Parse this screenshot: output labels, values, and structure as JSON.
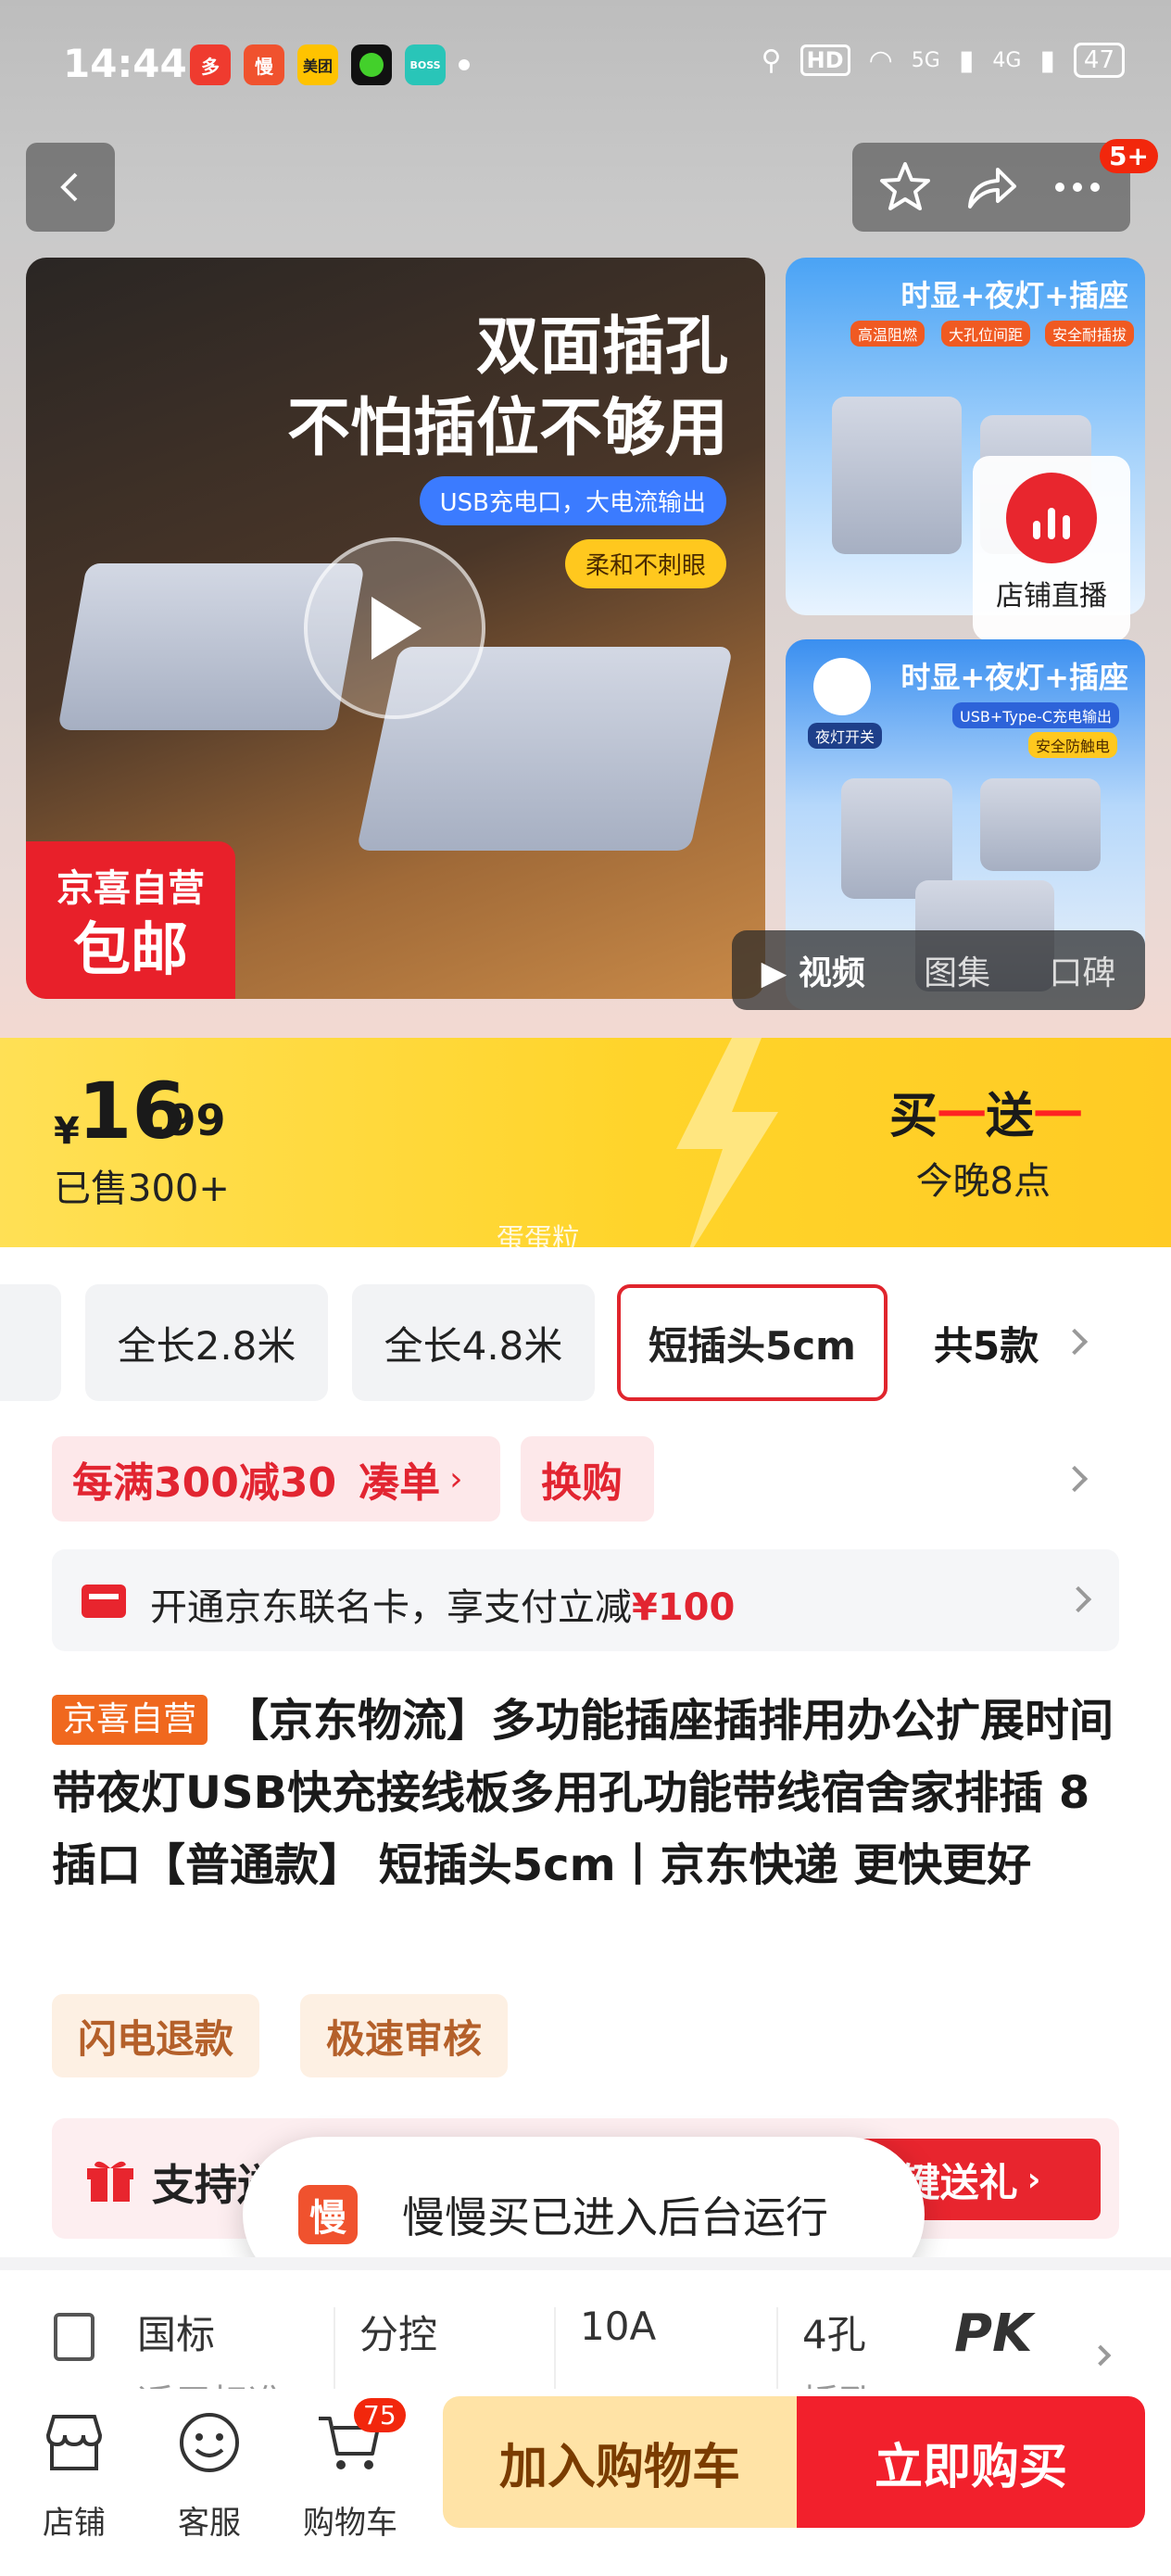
{
  "status_bar": {
    "time": "14:44",
    "app_icons": [
      {
        "name": "pinduoduo",
        "text": "多",
        "color": "#ef3b2f"
      },
      {
        "name": "manman",
        "text": "慢",
        "color": "#f0522e"
      },
      {
        "name": "meituan",
        "text": "美团",
        "color": "#ffc300"
      },
      {
        "name": "green-app",
        "text": "",
        "color": "#43d02b"
      },
      {
        "name": "boss",
        "text": "BOSS",
        "color": "#29c5b8"
      }
    ],
    "network_5g": "5G",
    "network_4g": "4G",
    "battery": "47"
  },
  "header": {
    "more_badge": "5+"
  },
  "gallery": {
    "headline_line1": "双面插孔",
    "headline_line2": "不怕插位不够用",
    "tag_usb": "USB充电口，大电流输出",
    "tag_soft": "柔和不刺眼",
    "badge_line1": "京喜自营",
    "badge_line2": "包邮",
    "side1_title": "时显+夜灯+插座",
    "side1_pills": [
      "高温阻燃",
      "大孔位间距",
      "安全耐插拔"
    ],
    "side2_title": "时显+夜灯+插座",
    "side2_pill1": "USB+Type-C充电输出",
    "side2_pill2": "安全防触电",
    "side2_pill3": "夜灯开关",
    "live_label": "店铺直播",
    "media_tabs": [
      "视频",
      "图集",
      "口碑"
    ]
  },
  "price": {
    "currency": "¥",
    "integer": "16",
    "decimal": ".99",
    "sold": "已售300+",
    "promo_a": "买",
    "promo_dash1": "一",
    "promo_b": "送",
    "promo_dash2": "一",
    "promo_time": "今晚8点",
    "watermark": "蛋蛋粒"
  },
  "sku": {
    "options": [
      "全长2.8米",
      "全长4.8米",
      "短插头5cm"
    ],
    "selected_index": 2,
    "more": "共5款"
  },
  "coupons": {
    "full_reduction": "每满300减30",
    "gather": "凑单",
    "exchange": "换购"
  },
  "card_offer": {
    "text": "开通京东联名卡，享支付立减",
    "amount": "¥100"
  },
  "product": {
    "store_tag": "京喜自营",
    "title": "【京东物流】多功能插座插排用办公扩展时间带夜灯USB快充接线板多用孔功能带线宿舍家排插 8插口【普通款】 短插头5cm丨京东快递 更快更好"
  },
  "services": [
    "闪电退款",
    "极速审核"
  ],
  "gift": {
    "label": "支持送",
    "button": "键送礼"
  },
  "toast": {
    "icon_text": "慢",
    "text": "慢慢买已进入后台运行"
  },
  "specs": [
    {
      "value": "国标",
      "sub": "适用标准"
    },
    {
      "value": "分控",
      "sub": ""
    },
    {
      "value": "10A",
      "sub": ""
    },
    {
      "value": "4孔",
      "sub": "插孔"
    }
  ],
  "pk_label": "PK",
  "bottom_nav": {
    "store": "店铺",
    "service": "客服",
    "cart": "购物车",
    "cart_count": "75",
    "add_to_cart": "加入购物车",
    "buy_now": "立即购买"
  },
  "colors": {
    "brand_red": "#e8252e",
    "price_yellow": "#ffd42a",
    "jingxi_orange": "#f0681e"
  }
}
